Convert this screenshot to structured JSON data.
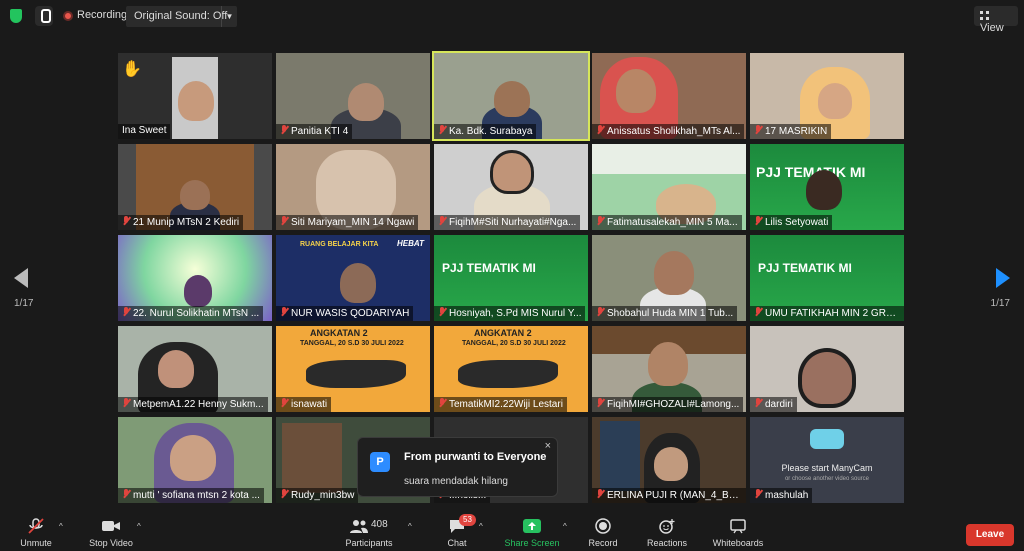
{
  "topbar": {
    "recording_label": "Recording",
    "original_sound": "Original Sound: Off",
    "view_label": "View"
  },
  "pagination": {
    "left": "1/17",
    "right": "1/17"
  },
  "participants": [
    {
      "name": "Ina Sweet",
      "muted": false,
      "hand": true
    },
    {
      "name": "Panitia KTI 4",
      "muted": true
    },
    {
      "name": "Ka. Bdk. Surabaya",
      "muted": true,
      "speaking": true
    },
    {
      "name": "Anissatus Sholikhah_MTs Al...",
      "muted": true
    },
    {
      "name": "17 MASRIKIN",
      "muted": true
    },
    {
      "name": "21 Munip MTsN 2 Kediri",
      "muted": true
    },
    {
      "name": "Siti Mariyam_MIN 14 Ngawi",
      "muted": true
    },
    {
      "name": "FiqihM#Siti Nurhayati#Nga...",
      "muted": true
    },
    {
      "name": "Fatimatusalekah_MIN 5 Ma...",
      "muted": true
    },
    {
      "name": "Lilis Setyowati",
      "muted": true
    },
    {
      "name": "22. Nurul Solikhatin MTsN ...",
      "muted": true
    },
    {
      "name": "NUR WASIS QODARIYAH",
      "muted": true
    },
    {
      "name": "Hosniyah, S.Pd MIS Nurul Y...",
      "muted": true
    },
    {
      "name": "Shobahul Huda MIN 1 Tub...",
      "muted": true
    },
    {
      "name": "UMU FATIKHAH MIN 2 GRE...",
      "muted": true
    },
    {
      "name": "MetpemA1.22 Henny Sukm...",
      "muted": true
    },
    {
      "name": "isnawati",
      "muted": true
    },
    {
      "name": "TematikMI2.22Wiji Lestari",
      "muted": true
    },
    {
      "name": "FiqihMI#GHOZALI#Lamong...",
      "muted": true
    },
    {
      "name": "dardiri",
      "muted": true
    },
    {
      "name": "mutti ' sofiana mtsn 2 kota ...",
      "muted": true
    },
    {
      "name": "Rudy_min3bw",
      "muted": true
    },
    {
      "name": "...nolis...",
      "muted": true
    },
    {
      "name": "ERLINA PUJI R (MAN_4_BA...",
      "muted": true
    },
    {
      "name": "mashulah",
      "muted": true
    }
  ],
  "tile_texts": {
    "ruang_belajar": "RUANG BELAJAR KITA",
    "hebat": "HEBAT",
    "pjj_tematik": "PJJ TEMATIK MI",
    "angkatan": "ANGKATAN 2",
    "tanggal": "TANGGAL, 20 S.D 30 JULI 2022",
    "manycam_msg": "Please start ManyCam",
    "manycam_sub": "or choose another video source"
  },
  "toast": {
    "avatar_letter": "P",
    "title": "From purwanti to Everyone",
    "message": "suara mendadak hilang",
    "close": "×"
  },
  "toolbar": {
    "unmute": "Unmute",
    "stop_video": "Stop Video",
    "participants_count": "408",
    "participants": "Participants",
    "chat": "Chat",
    "chat_badge": "53",
    "share_screen": "Share Screen",
    "record": "Record",
    "reactions": "Reactions",
    "whiteboards": "Whiteboards",
    "leave": "Leave"
  },
  "colors": {
    "accent_green": "#23c45e",
    "leave_red": "#d9372c",
    "speaker_outline": "#d6e65a",
    "link_blue": "#1e90ff"
  }
}
